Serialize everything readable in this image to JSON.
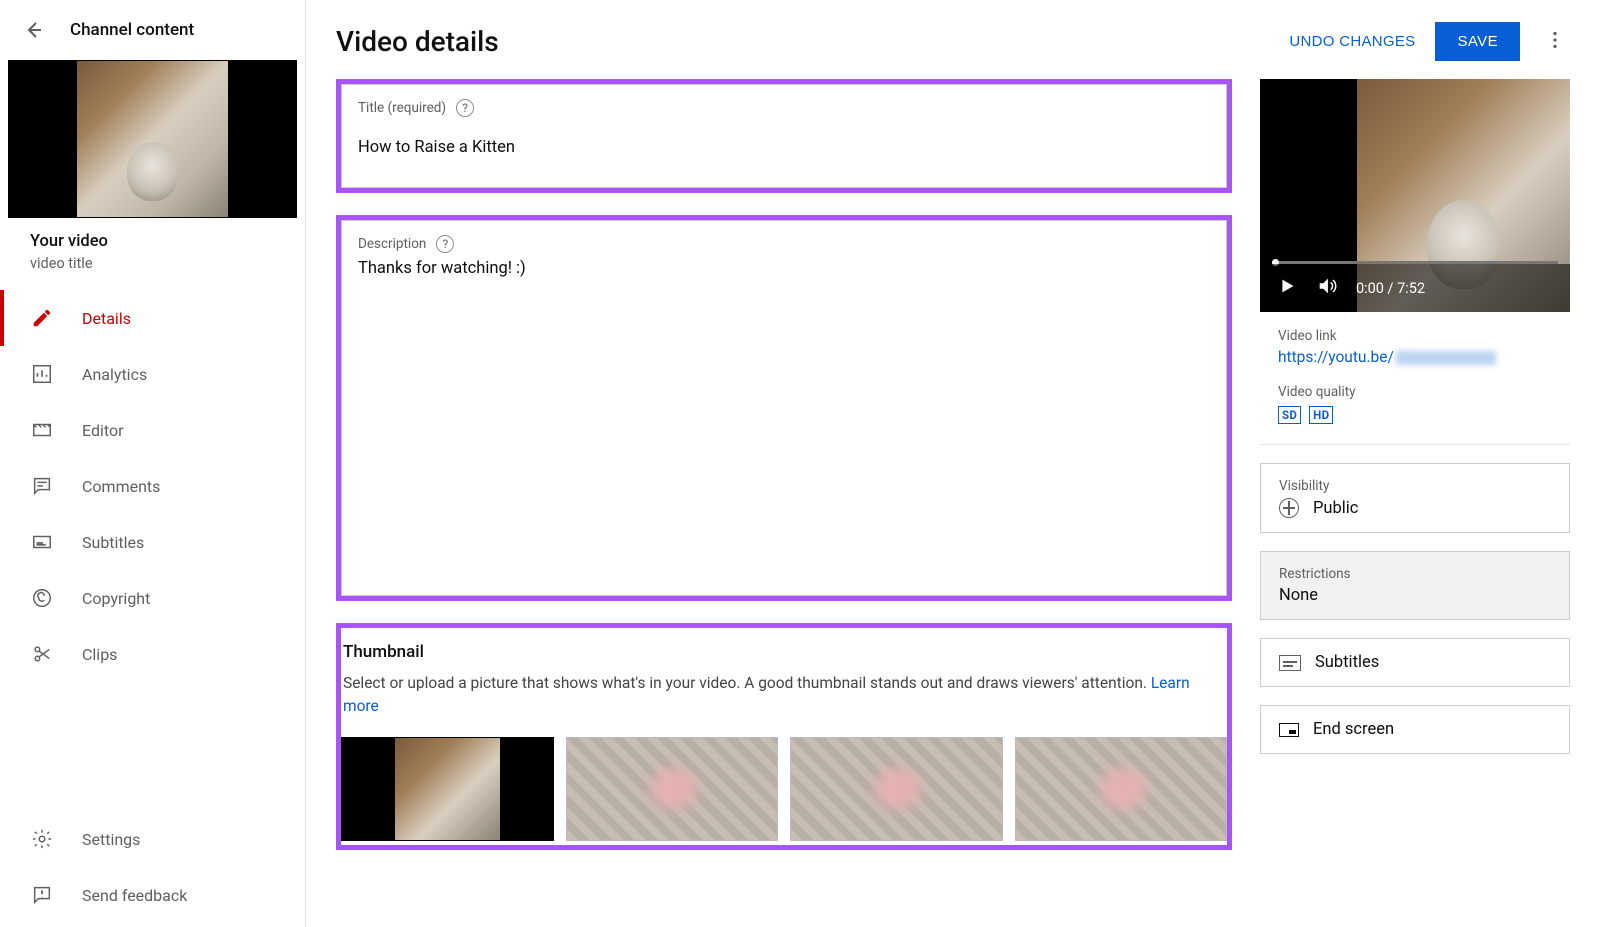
{
  "sidebar": {
    "back_label": "Back",
    "header": "Channel content",
    "your_video_label": "Your video",
    "video_title_sub": "video title",
    "nav": [
      {
        "label": "Details",
        "icon": "pencil"
      },
      {
        "label": "Analytics",
        "icon": "chart"
      },
      {
        "label": "Editor",
        "icon": "film"
      },
      {
        "label": "Comments",
        "icon": "comment"
      },
      {
        "label": "Subtitles",
        "icon": "cc"
      },
      {
        "label": "Copyright",
        "icon": "copyright"
      },
      {
        "label": "Clips",
        "icon": "scissors"
      }
    ],
    "bottom": [
      {
        "label": "Settings",
        "icon": "gear"
      },
      {
        "label": "Send feedback",
        "icon": "feedback"
      }
    ]
  },
  "header": {
    "title": "Video details",
    "undo": "UNDO CHANGES",
    "save": "SAVE"
  },
  "fields": {
    "title_label": "Title (required)",
    "title_value": "How to Raise a Kitten",
    "desc_label": "Description",
    "desc_value": "Thanks for watching! :)"
  },
  "thumbnail": {
    "heading": "Thumbnail",
    "body": "Select or upload a picture that shows what's in your video. A good thumbnail stands out and draws viewers' attention. ",
    "learn_more": "Learn more"
  },
  "player": {
    "time": "0:00 / 7:52"
  },
  "right": {
    "video_link_label": "Video link",
    "video_link_prefix": "https://youtu.be/",
    "quality_label": "Video quality",
    "sd": "SD",
    "hd": "HD",
    "visibility_label": "Visibility",
    "visibility_value": "Public",
    "restrictions_label": "Restrictions",
    "restrictions_value": "None",
    "subtitles_label": "Subtitles",
    "endscreen_label": "End screen"
  }
}
